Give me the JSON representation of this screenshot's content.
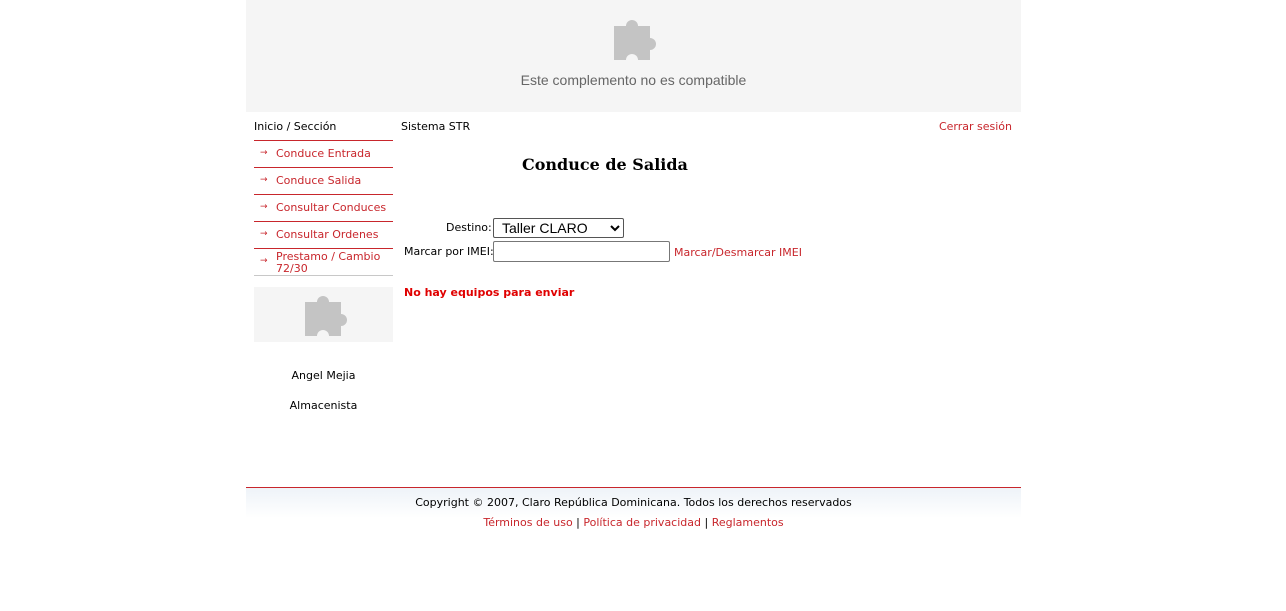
{
  "banner": {
    "message": "Este complemento no es compatible",
    "icon": "puzzle-icon"
  },
  "header": {
    "breadcrumb": "Inicio / Sección",
    "system": "Sistema STR",
    "logout": "Cerrar sesión"
  },
  "sidebar": {
    "items": [
      {
        "label": "Conduce Entrada"
      },
      {
        "label": "Conduce Salida"
      },
      {
        "label": "Consultar Conduces"
      },
      {
        "label": "Consultar Ordenes"
      },
      {
        "label": "Prestamo / Cambio 72/30"
      }
    ],
    "plugin_icon": "puzzle-icon",
    "user_name": "Angel Mejia",
    "user_role": "Almacenista"
  },
  "main": {
    "title": "Conduce de Salida",
    "destino_label": "Destino:",
    "destino_value": "Taller CLARO",
    "imei_label": "Marcar por IMEI:",
    "imei_value": "",
    "toggle_link": "Marcar/Desmarcar IMEI",
    "empty_message": "No hay equipos para enviar"
  },
  "footer": {
    "copyright": "Copyright © 2007, Claro República Dominicana. Todos los derechos reservados",
    "links": [
      "Términos de uso",
      "Política de privacidad",
      "Reglamentos"
    ],
    "separator": "|"
  },
  "colors": {
    "accent": "#c8262c",
    "error": "#e00000",
    "banner_bg": "#f5f5f5"
  }
}
